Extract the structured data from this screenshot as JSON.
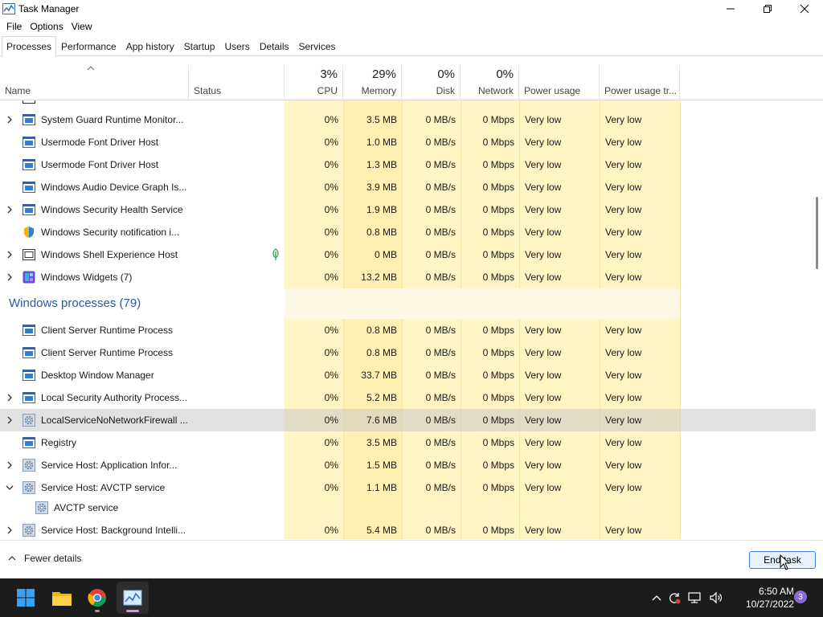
{
  "window": {
    "title": "Task Manager",
    "controls": [
      "minimize",
      "restore",
      "close"
    ]
  },
  "menu": [
    "File",
    "Options",
    "View"
  ],
  "tabs": [
    "Processes",
    "Performance",
    "App history",
    "Startup",
    "Users",
    "Details",
    "Services"
  ],
  "active_tab": "Processes",
  "columns": {
    "name": "Name",
    "status": "Status",
    "cpu": {
      "pct": "3%",
      "label": "CPU"
    },
    "memory": {
      "pct": "29%",
      "label": "Memory"
    },
    "disk": {
      "pct": "0%",
      "label": "Disk"
    },
    "network": {
      "pct": "0%",
      "label": "Network"
    },
    "power": "Power usage",
    "power_trend": "Power usage tr..."
  },
  "rows_top": [
    {
      "name": "System Guard Runtime Monitor...",
      "icon": "service-window-icon",
      "expand": true,
      "cpu": "0%",
      "mem": "3.5 MB",
      "disk": "0 MB/s",
      "net": "0 Mbps",
      "power": "Very low",
      "trend": "Very low"
    },
    {
      "name": "Usermode Font Driver Host",
      "icon": "service-window-icon",
      "expand": false,
      "cpu": "0%",
      "mem": "1.0 MB",
      "disk": "0 MB/s",
      "net": "0 Mbps",
      "power": "Very low",
      "trend": "Very low"
    },
    {
      "name": "Usermode Font Driver Host",
      "icon": "service-window-icon",
      "expand": false,
      "cpu": "0%",
      "mem": "1.3 MB",
      "disk": "0 MB/s",
      "net": "0 Mbps",
      "power": "Very low",
      "trend": "Very low"
    },
    {
      "name": "Windows Audio Device Graph Is...",
      "icon": "service-window-icon",
      "expand": false,
      "cpu": "0%",
      "mem": "3.9 MB",
      "disk": "0 MB/s",
      "net": "0 Mbps",
      "power": "Very low",
      "trend": "Very low"
    },
    {
      "name": "Windows Security Health Service",
      "icon": "service-window-icon",
      "expand": true,
      "cpu": "0%",
      "mem": "1.9 MB",
      "disk": "0 MB/s",
      "net": "0 Mbps",
      "power": "Very low",
      "trend": "Very low"
    },
    {
      "name": "Windows Security notification i...",
      "icon": "security-shield-icon",
      "expand": false,
      "cpu": "0%",
      "mem": "0.8 MB",
      "disk": "0 MB/s",
      "net": "0 Mbps",
      "power": "Very low",
      "trend": "Very low"
    },
    {
      "name": "Windows Shell Experience Host",
      "icon": "shell-host-icon",
      "expand": true,
      "status_icon": "leaf-icon",
      "cpu": "0%",
      "mem": "0 MB",
      "disk": "0 MB/s",
      "net": "0 Mbps",
      "power": "Very low",
      "trend": "Very low"
    },
    {
      "name": "Windows Widgets (7)",
      "icon": "widgets-icon",
      "expand": true,
      "cpu": "0%",
      "mem": "13.2 MB",
      "disk": "0 MB/s",
      "net": "0 Mbps",
      "power": "Very low",
      "trend": "Very low"
    }
  ],
  "group": {
    "title": "Windows processes (79)"
  },
  "rows_bottom": [
    {
      "name": "Client Server Runtime Process",
      "icon": "service-window-icon",
      "expand": false,
      "cpu": "0%",
      "mem": "0.8 MB",
      "disk": "0 MB/s",
      "net": "0 Mbps",
      "power": "Very low",
      "trend": "Very low"
    },
    {
      "name": "Client Server Runtime Process",
      "icon": "service-window-icon",
      "expand": false,
      "cpu": "0%",
      "mem": "0.8 MB",
      "disk": "0 MB/s",
      "net": "0 Mbps",
      "power": "Very low",
      "trend": "Very low"
    },
    {
      "name": "Desktop Window Manager",
      "icon": "service-window-icon",
      "expand": false,
      "cpu": "0%",
      "mem": "33.7 MB",
      "disk": "0 MB/s",
      "net": "0 Mbps",
      "power": "Very low",
      "trend": "Very low"
    },
    {
      "name": "Local Security Authority Process...",
      "icon": "service-window-icon",
      "expand": true,
      "cpu": "0%",
      "mem": "5.2 MB",
      "disk": "0 MB/s",
      "net": "0 Mbps",
      "power": "Very low",
      "trend": "Very low"
    },
    {
      "name": "LocalServiceNoNetworkFirewall ...",
      "icon": "gear-icon",
      "expand": true,
      "selected": true,
      "cpu": "0%",
      "mem": "7.6 MB",
      "disk": "0 MB/s",
      "net": "0 Mbps",
      "power": "Very low",
      "trend": "Very low"
    },
    {
      "name": "Registry",
      "icon": "service-window-icon",
      "expand": false,
      "cpu": "0%",
      "mem": "3.5 MB",
      "disk": "0 MB/s",
      "net": "0 Mbps",
      "power": "Very low",
      "trend": "Very low"
    },
    {
      "name": "Service Host: Application Infor...",
      "icon": "gear-icon",
      "expand": true,
      "cpu": "0%",
      "mem": "1.5 MB",
      "disk": "0 MB/s",
      "net": "0 Mbps",
      "power": "Very low",
      "trend": "Very low"
    },
    {
      "name": "Service Host: AVCTP service",
      "icon": "gear-icon",
      "expand": true,
      "expanded": true,
      "cpu": "0%",
      "mem": "1.1 MB",
      "disk": "0 MB/s",
      "net": "0 Mbps",
      "power": "Very low",
      "trend": "Very low"
    },
    {
      "name": "AVCTP service",
      "icon": "gear-icon",
      "child": true,
      "cpu": "",
      "mem": "",
      "disk": "",
      "net": "",
      "power": "",
      "trend": ""
    },
    {
      "name": "Service Host: Background Intelli...",
      "icon": "gear-icon",
      "expand": true,
      "cpu": "0%",
      "mem": "5.4 MB",
      "disk": "0 MB/s",
      "net": "0 Mbps",
      "power": "Very low",
      "trend": "Very low"
    }
  ],
  "footer": {
    "fewer_details": "Fewer details",
    "end_task": "End task"
  },
  "taskbar": {
    "apps": [
      "start-icon",
      "file-explorer-icon",
      "chrome-icon",
      "task-manager-icon"
    ],
    "tray_icons": [
      "chevron-up-icon",
      "sync-icon",
      "network-icon",
      "volume-icon"
    ],
    "time": "6:50 AM",
    "date": "10/27/2022",
    "notification_count": "3"
  },
  "colors": {
    "accent": "#2b5aa6",
    "heat_light": "#fff4c4",
    "heat_mem": "#ffefb0",
    "taskbar": "#1c1c1c"
  }
}
